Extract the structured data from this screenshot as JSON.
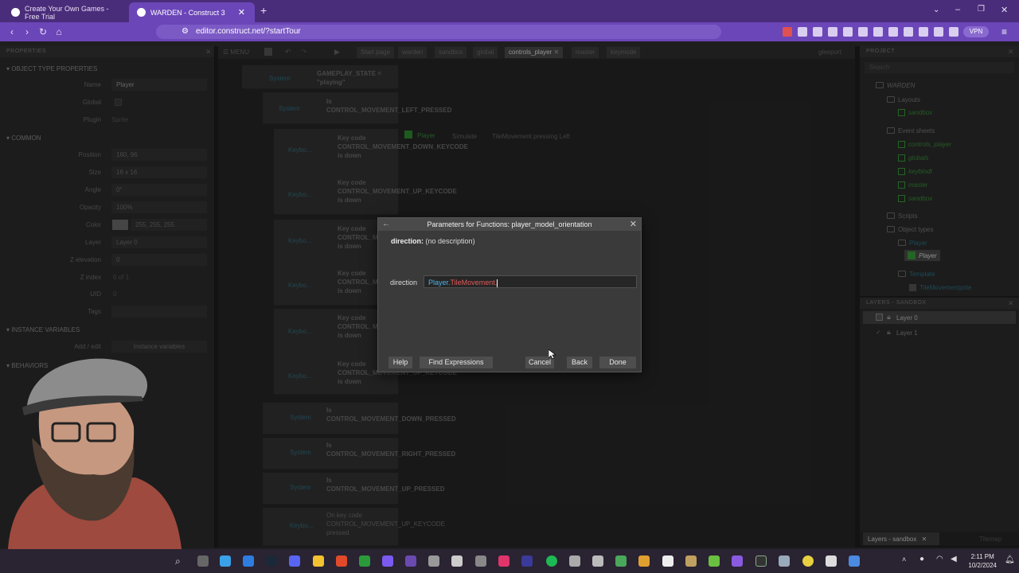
{
  "browser": {
    "tabs": [
      {
        "title": "Create Your Own Games - Free Trial",
        "active": false
      },
      {
        "title": "WARDEN - Construct 3",
        "active": true
      }
    ],
    "new_tab": "+",
    "url": "editor.construct.net/?startTour",
    "vpn": "VPN"
  },
  "properties": {
    "header": "PROPERTIES",
    "section_object": "OBJECT TYPE PROPERTIES",
    "name_label": "Name",
    "name_value": "Player",
    "global_label": "Global",
    "plugin_label": "Plugin",
    "plugin_value": "Sprite",
    "section_common": "COMMON",
    "rows": [
      {
        "label": "Position",
        "value": "160, 96"
      },
      {
        "label": "Size",
        "value": "16 x 16"
      },
      {
        "label": "Angle",
        "value": "0°"
      },
      {
        "label": "Opacity",
        "value": "100%"
      },
      {
        "label": "Color",
        "value": "255, 255, 255"
      },
      {
        "label": "Layer",
        "value": "Layer 0"
      },
      {
        "label": "Z elevation",
        "value": "0"
      },
      {
        "label": "Z index",
        "value": "0 of 1"
      },
      {
        "label": "UID",
        "value": "0"
      },
      {
        "label": "Tags",
        "value": ""
      }
    ],
    "section_instvars": "INSTANCE VARIABLES",
    "addedit_label": "Add / edit",
    "addedit_value": "Instance variables",
    "section_behaviors": "BEHAVIORS"
  },
  "eventsheet": {
    "menu": "MENU",
    "tabs": [
      "Start page",
      "warden",
      "sandbox",
      "global",
      "controls_player",
      "master",
      "keymode"
    ],
    "active_tab": "controls_player",
    "right_label": "gleeport",
    "events": [
      {
        "obj": "System",
        "cond": "GAMEPLAY_STATE = \"playing\""
      },
      {
        "obj": "System",
        "cond": "Is CONTROL_MOVEMENT_LEFT_PRESSED"
      },
      {
        "obj": "Keybo...",
        "cond": "Key code CONTROL_MOVEMENT_DOWN_KEYCODE is down"
      },
      {
        "obj": "Keybo...",
        "cond": "Key code CONTROL_MOVEMENT_UP_KEYCODE is down"
      },
      {
        "obj": "Keybo...",
        "cond": "Key code CONTROL_MOVEMENT_DOWN_KEYCODE is down"
      },
      {
        "obj": "Keybo...",
        "cond": "Key code CONTROL_MOVEMENT_UP_KEYCODE is down"
      },
      {
        "obj": "Keybo...",
        "cond": "Key code CONTROL_MOVEMENT_DOWN_KEYCODE is down"
      },
      {
        "obj": "Keybo...",
        "cond": "Key code CONTROL_MOVEMENT_UP_KEYCODE is down"
      },
      {
        "obj": "System",
        "cond": "Is CONTROL_MOVEMENT_DOWN_PRESSED"
      },
      {
        "obj": "System",
        "cond": "Is CONTROL_MOVEMENT_RIGHT_PRESSED"
      },
      {
        "obj": "System",
        "cond": "Is CONTROL_MOVEMENT_UP_PRESSED"
      },
      {
        "obj": "Keybo...",
        "cond": "On key code CONTROL_MOVEMENT_UP_KEYCODE pressed"
      }
    ],
    "action": {
      "obj": "Player",
      "text": "Simulate",
      "beh": "TileMovement pressing Left"
    }
  },
  "project": {
    "header": "PROJECT",
    "search": "Search",
    "root": "WARDEN",
    "layouts": "Layouts",
    "layout_items": [
      "sandbox"
    ],
    "eventsheets": "Event sheets",
    "sheet_items": [
      "controls_player",
      "globals",
      "keybindt",
      "master",
      "sandbox"
    ],
    "scripts": "Scripts",
    "objtypes": "Object types",
    "player_folder": "Player",
    "player_item": "Player",
    "template": "Template",
    "template_item": "TileMovementprite"
  },
  "layers": {
    "header": "LAYERS - SANDBOX",
    "items": [
      "Layer 0",
      "Layer 1"
    ],
    "tab_active": "Layers - sandbox",
    "tab_other": "Tilemap"
  },
  "dialog": {
    "title": "Parameters for Functions: player_model_orientation",
    "param_name": "direction:",
    "param_desc": "(no description)",
    "field_label": "direction",
    "value_obj": "Player.",
    "value_beh": "TileMovement.",
    "buttons": {
      "help": "Help",
      "find": "Find Expressions",
      "cancel": "Cancel",
      "back": "Back",
      "done": "Done"
    }
  },
  "taskbar": {
    "time": "2:11 PM",
    "date": "10/2/2024"
  },
  "colors": {
    "browser_tabbar": "#4a2d7a",
    "browser_address": "#6b46b8",
    "editor_bg": "#262626",
    "dialog_bg": "#3a3a3a",
    "expr_object": "#4fb3e8",
    "expr_behavior": "#e25a5a",
    "sheet_green": "#3b9a3b"
  }
}
